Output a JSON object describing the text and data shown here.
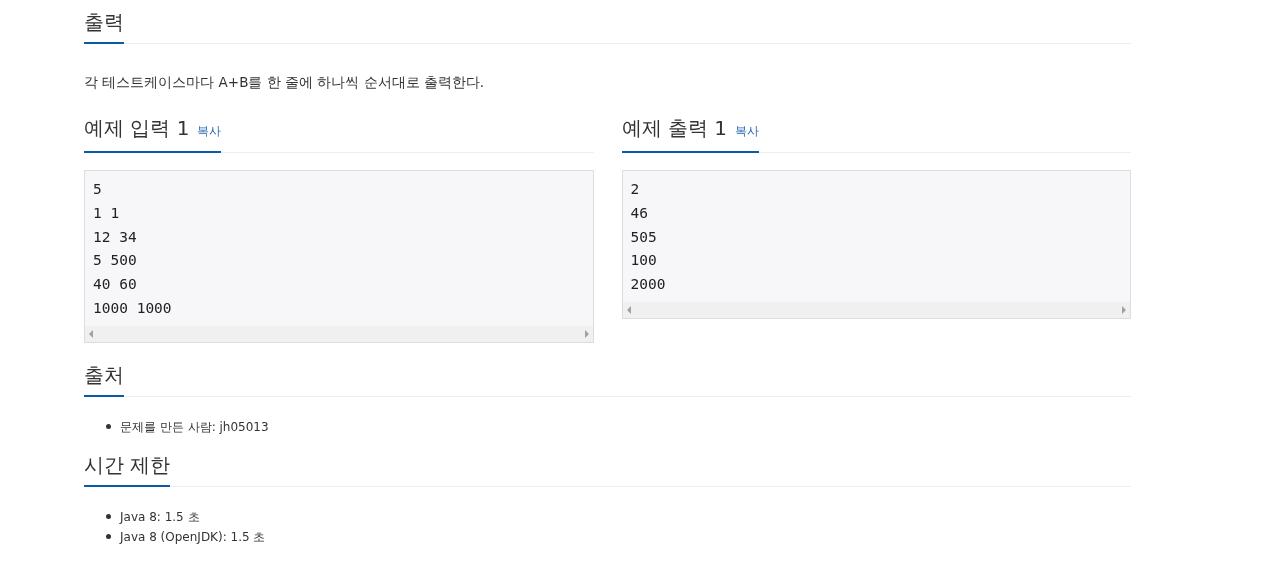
{
  "sections": [
    {
      "kind": "text",
      "title": "출력",
      "text": "각 테스트케이스마다 A+B를 한 줄에 하나씩 순서대로 출력한다."
    },
    {
      "kind": "samples",
      "samples": [
        {
          "title": "예제 입력 1",
          "copy": "복사",
          "lines": [
            "5",
            "1 1",
            "12 34",
            "5 500",
            "40 60",
            "1000 1000"
          ]
        },
        {
          "title": "예제 출력 1",
          "copy": "복사",
          "lines": [
            "2",
            "46",
            "505",
            "100",
            "2000"
          ]
        }
      ]
    },
    {
      "kind": "list",
      "title": "출처",
      "items": [
        "문제를 만든 사람: jh05013"
      ]
    },
    {
      "kind": "list",
      "title": "시간 제한",
      "items": [
        "Java 8: 1.5 초",
        "Java 8 (OpenJDK): 1.5 초"
      ]
    }
  ]
}
